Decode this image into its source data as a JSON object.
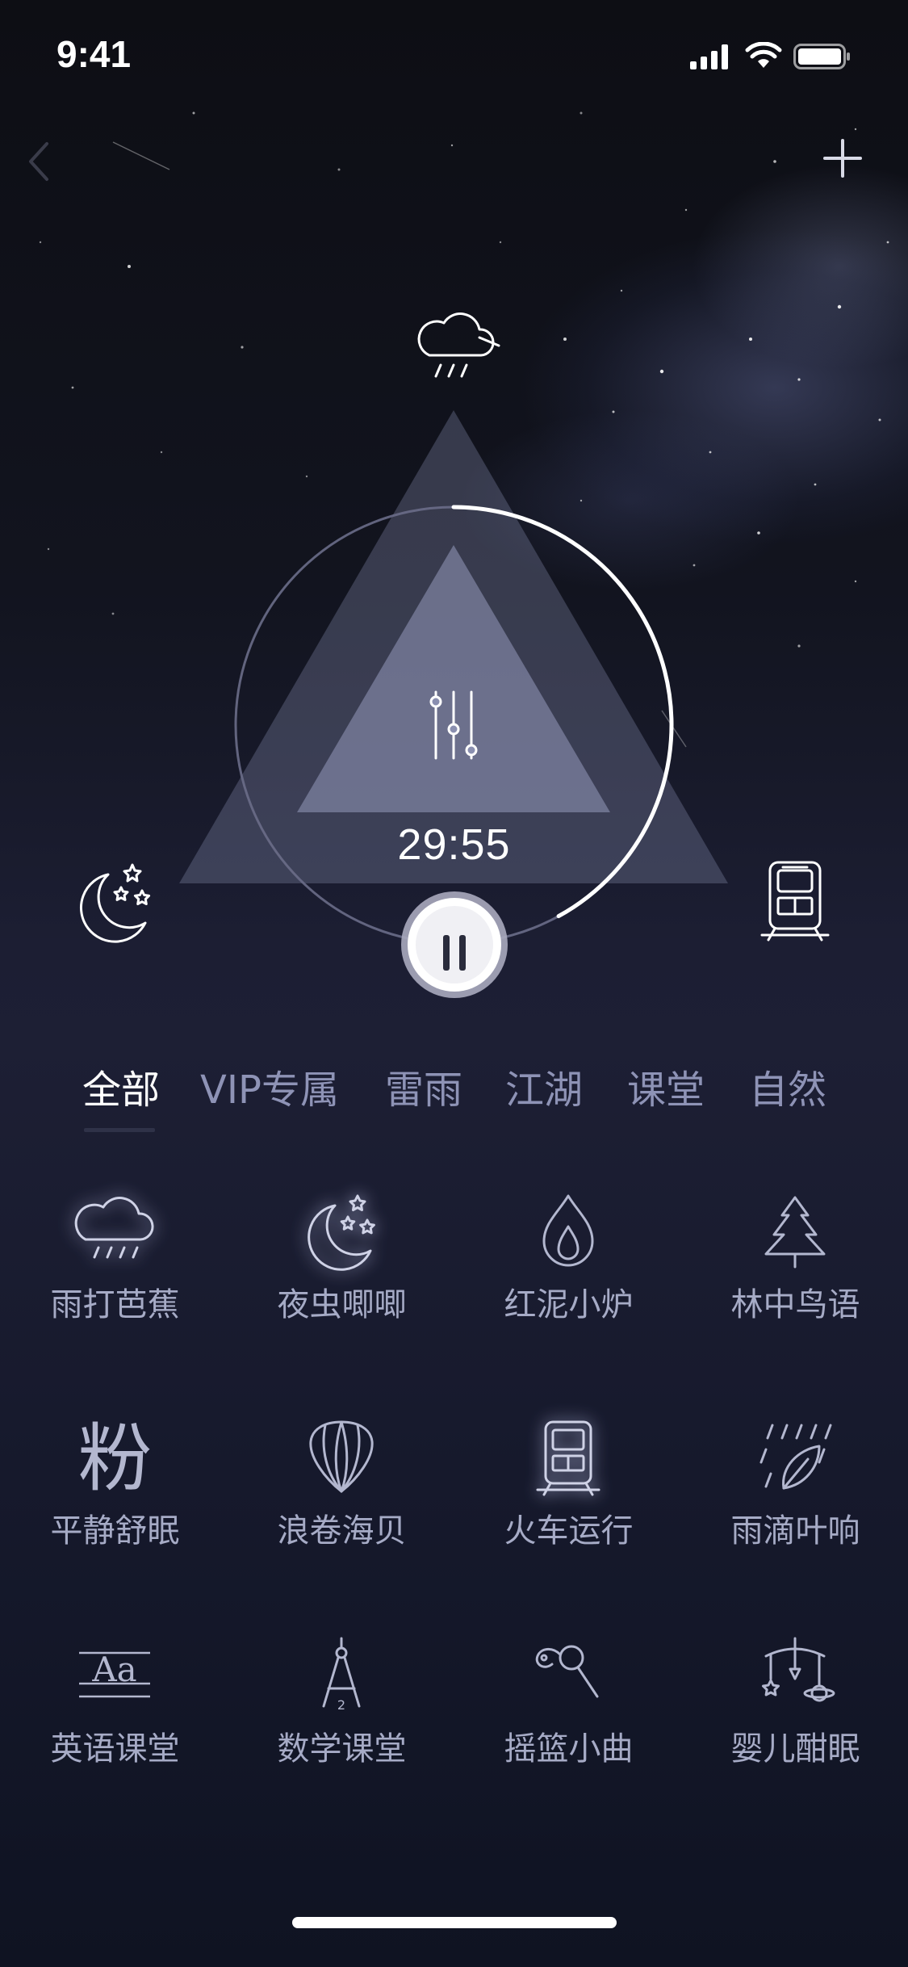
{
  "status_bar": {
    "time": "9:41",
    "icons": [
      "signal-icon",
      "wifi-icon",
      "battery-icon"
    ]
  },
  "nav": {
    "back_icon": "chevron-left-icon",
    "add_icon": "plus-icon"
  },
  "player": {
    "remaining_time": "29:55",
    "progress_fraction": 0.42,
    "top_icon": "rain-cloud-icon",
    "left_icon": "moon-stars-icon",
    "right_icon": "train-icon",
    "center_icon": "equalizer-sliders-icon",
    "pause_icon": "pause-icon"
  },
  "tabs": [
    {
      "label": "全部",
      "active": true
    },
    {
      "label": "VIP专属",
      "active": false
    },
    {
      "label": "雷雨",
      "active": false
    },
    {
      "label": "江湖",
      "active": false
    },
    {
      "label": "课堂",
      "active": false
    },
    {
      "label": "自然",
      "active": false
    }
  ],
  "sounds": [
    {
      "label": "雨打芭蕉",
      "icon": "rain-cloud-icon",
      "active": true
    },
    {
      "label": "夜虫唧唧",
      "icon": "moon-stars-icon",
      "active": true
    },
    {
      "label": "红泥小炉",
      "icon": "flame-icon",
      "active": false
    },
    {
      "label": "林中鸟语",
      "icon": "pine-tree-icon",
      "active": false
    },
    {
      "label": "平静舒眠",
      "icon": "text-glyph-icon",
      "glyph": "粉",
      "active": false
    },
    {
      "label": "浪卷海贝",
      "icon": "seashell-icon",
      "active": false
    },
    {
      "label": "火车运行",
      "icon": "train-icon",
      "active": true
    },
    {
      "label": "雨滴叶响",
      "icon": "rain-leaf-icon",
      "active": false
    },
    {
      "label": "英语课堂",
      "icon": "aa-text-icon",
      "glyph": "Aa",
      "active": false
    },
    {
      "label": "数学课堂",
      "icon": "compass-icon",
      "glyph": "2",
      "active": false
    },
    {
      "label": "摇篮小曲",
      "icon": "rattle-icon",
      "active": false
    },
    {
      "label": "婴儿酣眠",
      "icon": "baby-mobile-icon",
      "active": false
    }
  ],
  "colors": {
    "tab_inactive": "#8e93b6",
    "tab_active": "#ffffff",
    "label": "#a6abc6",
    "triangle": "#8a8fb0"
  }
}
